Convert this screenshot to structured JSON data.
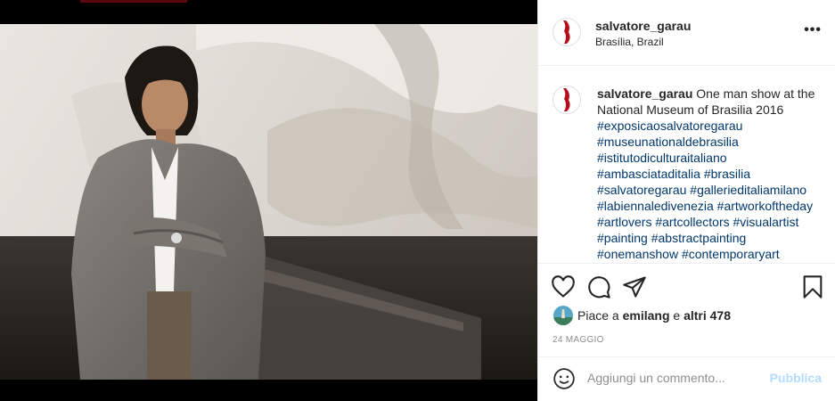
{
  "post": {
    "username": "salvatore_garau",
    "location": "Brasília, Brazil",
    "more_label": "•••",
    "caption_user": "salvatore_garau",
    "caption_text": " One man show at the National Museum of Brasilia 2016",
    "hashtags": [
      "#exposicaosalvatoregarau",
      "#museunationaldebrasilia",
      "#istitutodiculturaitaliano",
      "#ambasciataditalia",
      "#brasilia",
      "#salvatoregarau",
      "#gallerieditaliamilano",
      "#labiennaledivenezia",
      "#artworkoftheday",
      "#artlovers",
      "#artcollectors",
      "#visualartist",
      "#painting",
      "#abstractpainting",
      "#onemanshow",
      "#contemporaryart"
    ],
    "likes_prefix": "Piace a ",
    "likes_user": "emilang",
    "likes_mid": " e ",
    "likes_count": "altri 478",
    "date": "24 MAGGIO"
  },
  "comment": {
    "placeholder": "Aggiungi un commento...",
    "publish_label": "Pubblica"
  },
  "icons": {
    "like": "heart-icon",
    "comment": "comment-icon",
    "share": "share-icon",
    "save": "bookmark-icon",
    "emoji": "emoji-icon",
    "more": "more-icon"
  },
  "colors": {
    "hashtag": "#00376b",
    "publish_disabled": "#b3dbff",
    "meta_gray": "#8e8e8e"
  }
}
